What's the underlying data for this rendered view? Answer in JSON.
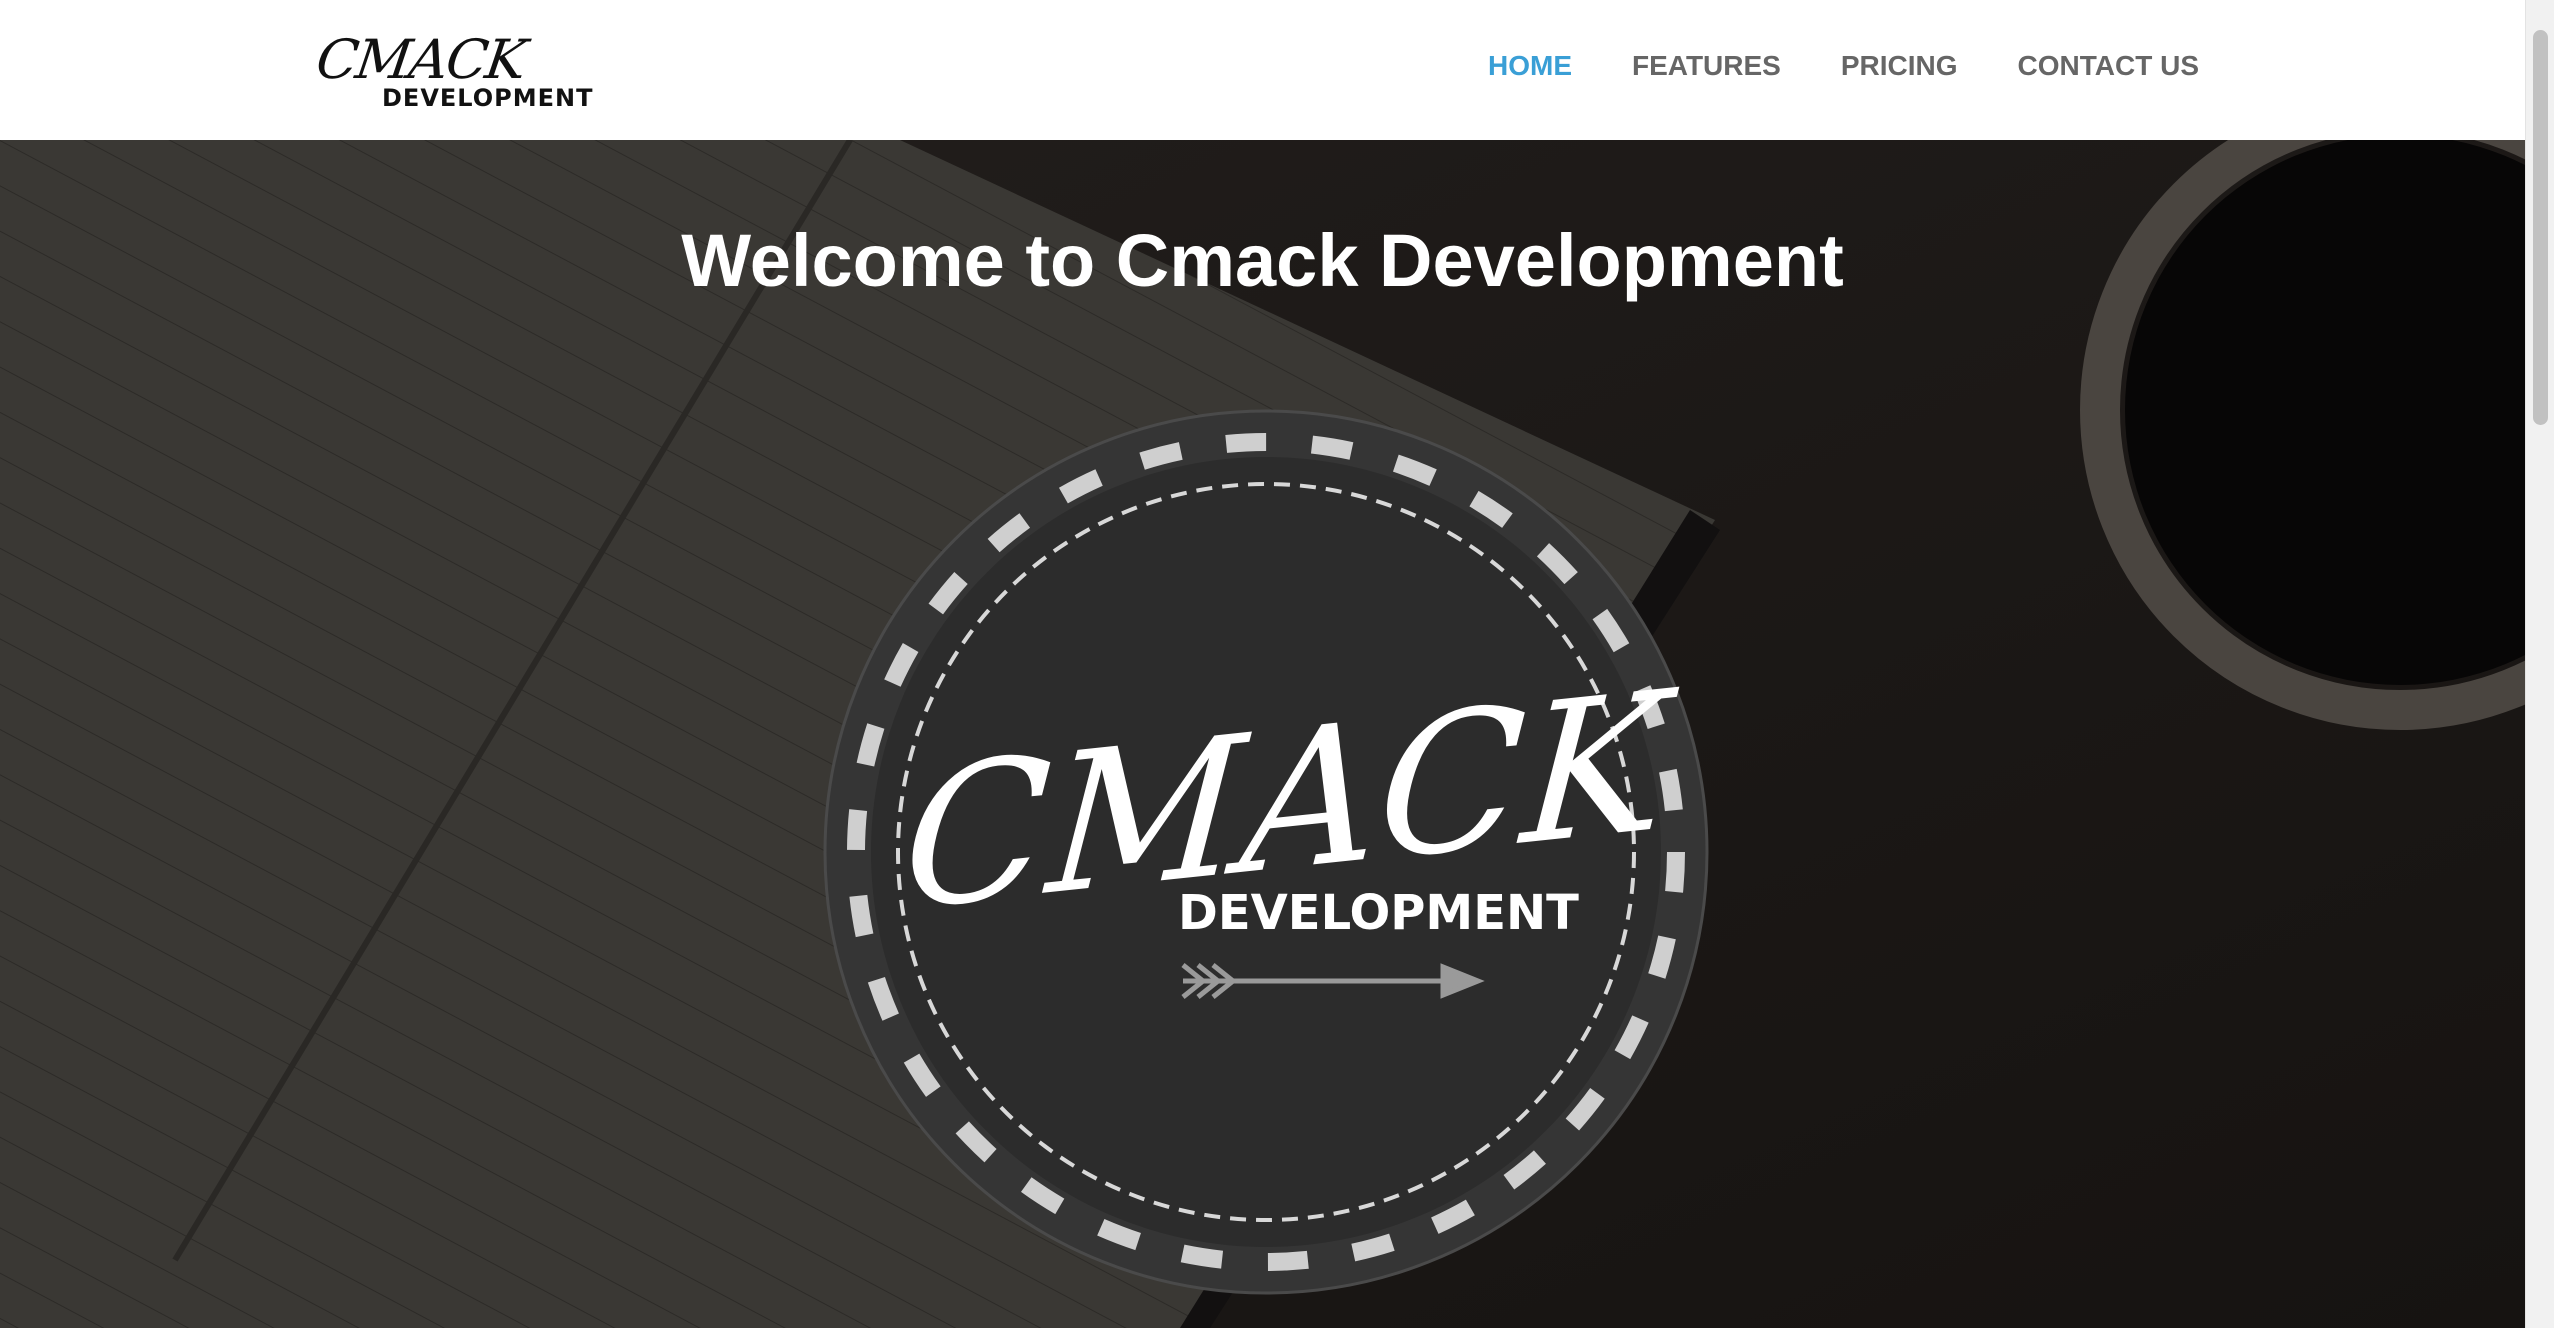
{
  "header": {
    "logo": {
      "script_text": "CMACK",
      "sub_text": "DEVELOPMENT"
    },
    "nav": [
      {
        "label": "HOME",
        "active": true
      },
      {
        "label": "FEATURES",
        "active": false
      },
      {
        "label": "PRICING",
        "active": false
      },
      {
        "label": "CONTACT US",
        "active": false
      }
    ]
  },
  "hero": {
    "title": "Welcome to Cmack Development",
    "badge": {
      "script_text": "CMACK",
      "sub_text": "DEVELOPMENT"
    }
  },
  "colors": {
    "accent": "#3a9fd6",
    "nav_text": "#666666"
  }
}
